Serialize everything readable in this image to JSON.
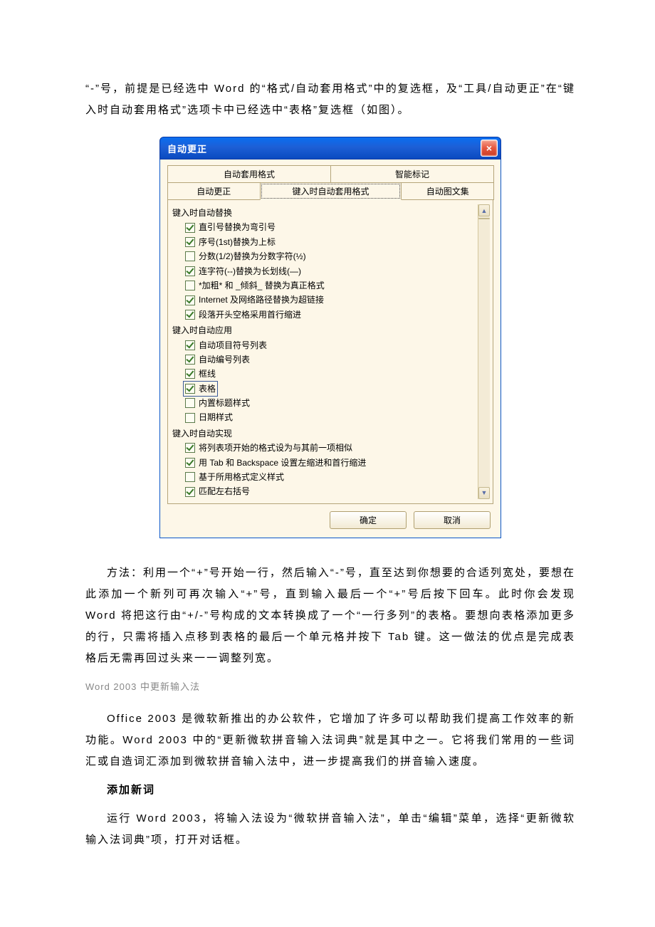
{
  "body": {
    "p1": "“-”号，前提是已经选中 Word 的“格式/自动套用格式”中的复选框，及“工具/自动更正”在“键入时自动套用格式”选项卡中已经选中“表格”复选框（如图）。",
    "p2": "方法：利用一个“+”号开始一行，然后输入“-”号，直至达到你想要的合适列宽处，要想在此添加一个新列可再次输入“+”号，直到输入最后一个“+”号后按下回车。此时你会发现 Word 将把这行由“+/-”号构成的文本转换成了一个“一行多列”的表格。要想向表格添加更多的行，只需将插入点移到表格的最后一个单元格并按下 Tab 键。这一做法的优点是完成表格后无需再回过头来一一调整列宽。",
    "sub": "Word 2003 中更新输入法",
    "p3": "Office 2003 是微软新推出的办公软件，它增加了许多可以帮助我们提高工作效率的新功能。Word 2003 中的“更新微软拼音输入法词典”就是其中之一。它将我们常用的一些词汇或自造词汇添加到微软拼音输入法中，进一步提高我们的拼音输入速度。",
    "h1": "添加新词",
    "p4": "运行 Word 2003，将输入法设为“微软拼音输入法”，单击“编辑”菜单，选择“更新微软输入法词典”项，打开对话框。"
  },
  "dialog": {
    "title": "自动更正",
    "tabs_top": [
      "自动套用格式",
      "智能标记"
    ],
    "tabs_bottom": [
      "自动更正",
      "键入时自动套用格式",
      "自动图文集"
    ],
    "group1": "键入时自动替换",
    "c1": "直引号替换为弯引号",
    "c2": "序号(1st)替换为上标",
    "c3": "分数(1/2)替换为分数字符(½)",
    "c4": "连字符(--)替换为长划线(—)",
    "c5": "*加粗* 和 _倾斜_ 替换为真正格式",
    "c6": "Internet 及网络路径替换为超链接",
    "c7": "段落开头空格采用首行缩进",
    "group2": "键入时自动应用",
    "c8": "自动项目符号列表",
    "c9": "自动编号列表",
    "c10": "框线",
    "c11": "表格",
    "c12": "内置标题样式",
    "c13": "日期样式",
    "group3": "键入时自动实现",
    "c14": "将列表项开始的格式设为与其前一项相似",
    "c15": "用 Tab 和 Backspace 设置左缩进和首行缩进",
    "c16": "基于所用格式定义样式",
    "c17": "匹配左右括号",
    "ok": "确定",
    "cancel": "取消"
  }
}
